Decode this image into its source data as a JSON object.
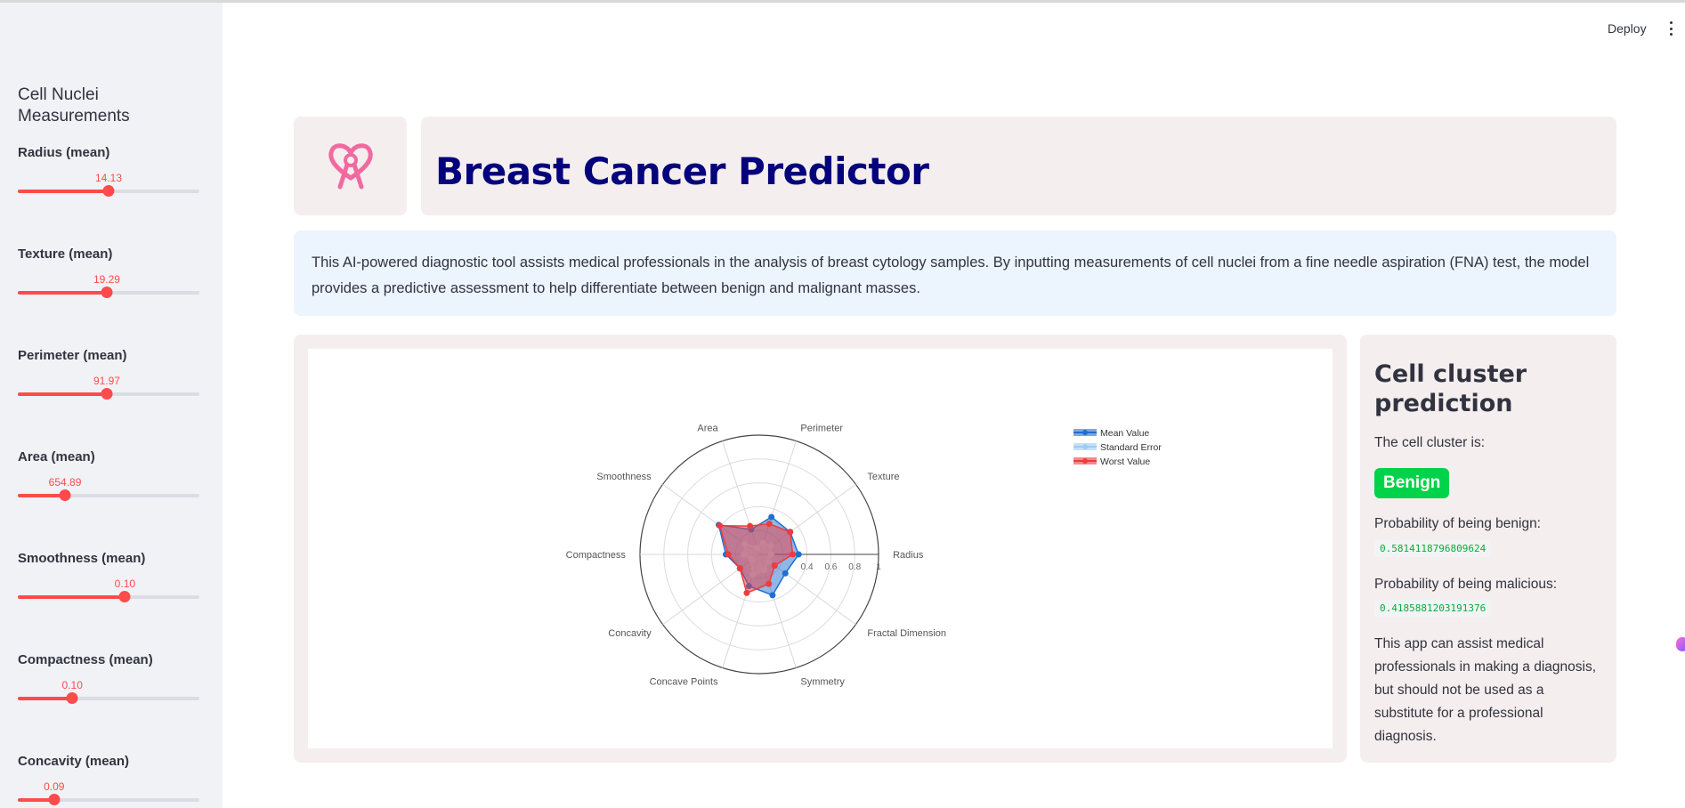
{
  "header": {
    "deploy_label": "Deploy"
  },
  "sidebar": {
    "title": "Cell Nuclei Measurements",
    "sliders": [
      {
        "label": "Radius (mean)",
        "value": "14.13",
        "fraction": 0.5
      },
      {
        "label": "Texture (mean)",
        "value": "19.29",
        "fraction": 0.49
      },
      {
        "label": "Perimeter (mean)",
        "value": "91.97",
        "fraction": 0.49
      },
      {
        "label": "Area (mean)",
        "value": "654.89",
        "fraction": 0.26
      },
      {
        "label": "Smoothness (mean)",
        "value": "0.10",
        "fraction": 0.59
      },
      {
        "label": "Compactness (mean)",
        "value": "0.10",
        "fraction": 0.3
      },
      {
        "label": "Concavity (mean)",
        "value": "0.09",
        "fraction": 0.2
      }
    ]
  },
  "main": {
    "title": "Breast Cancer Predictor",
    "description": "This AI-powered diagnostic tool assists medical professionals in the analysis of breast cytology samples. By inputting measurements of cell nuclei from a fine needle aspiration (FNA) test, the model provides a predictive assessment to help differentiate between benign and malignant masses."
  },
  "prediction": {
    "title": "Cell cluster prediction",
    "cluster_label": "The cell cluster is:",
    "result": "Benign",
    "benign_label": "Probability of being benign:",
    "benign_value": "0.5814118796809624",
    "malicious_label": "Probability of being malicious:",
    "malicious_value": "0.4185881203191376",
    "disclaimer": "This app can assist medical professionals in making a diagnosis, but should not be used as a substitute for a professional diagnosis."
  },
  "chart_data": {
    "type": "radar",
    "categories": [
      "Radius",
      "Texture",
      "Perimeter",
      "Area",
      "Smoothness",
      "Compactness",
      "Concavity",
      "Concave Points",
      "Symmetry",
      "Fractal Dimension"
    ],
    "radial_ticks": [
      "0.4",
      "0.6",
      "0.8",
      "1"
    ],
    "radial_range": [
      0,
      1
    ],
    "series": [
      {
        "name": "Mean Value",
        "color": "#1f6fd1",
        "values": [
          0.33,
          0.32,
          0.33,
          0.22,
          0.42,
          0.28,
          0.2,
          0.28,
          0.36,
          0.27
        ]
      },
      {
        "name": "Standard Error",
        "color": "#9ecbf0",
        "values": [
          0.1,
          0.12,
          0.1,
          0.06,
          0.15,
          0.13,
          0.08,
          0.18,
          0.14,
          0.1
        ]
      },
      {
        "name": "Worst Value",
        "color": "#ef3b3b",
        "values": [
          0.28,
          0.32,
          0.27,
          0.25,
          0.41,
          0.26,
          0.2,
          0.34,
          0.26,
          0.16
        ]
      }
    ],
    "legend_position": "top-right"
  }
}
